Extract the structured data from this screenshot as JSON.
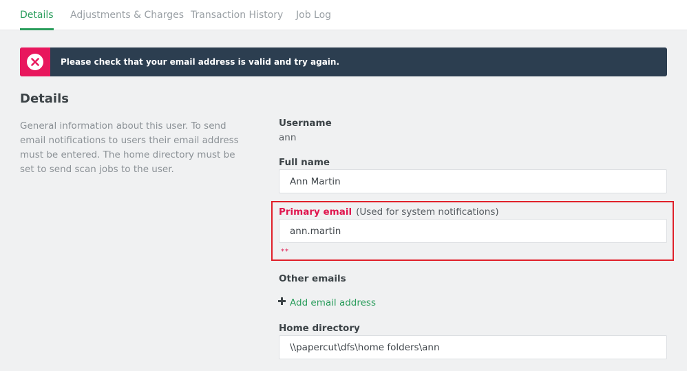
{
  "tabs": [
    {
      "label": "Details",
      "active": true
    },
    {
      "label": "Adjustments & Charges",
      "active": false
    },
    {
      "label": "Transaction History",
      "active": false
    },
    {
      "label": "Job Log",
      "active": false
    }
  ],
  "alert": {
    "message": "Please check that your email address is valid and try again.",
    "icon": "close-circle-icon",
    "color": "#e8175d"
  },
  "section": {
    "title": "Details",
    "description": "General information about this user. To send email notifications to users their email address must be entered. The home directory must be set to send scan jobs to the user."
  },
  "fields": {
    "username": {
      "label": "Username",
      "value": "ann"
    },
    "full_name": {
      "label": "Full name",
      "value": "Ann Martin"
    },
    "primary_email": {
      "label": "Primary email",
      "note": "(Used for system notifications)",
      "value": "ann.martin",
      "error": "**"
    },
    "other_emails": {
      "label": "Other emails",
      "add_label": "Add email address"
    },
    "home_directory": {
      "label": "Home directory",
      "value": "\\\\papercut\\dfs\\home folders\\ann"
    }
  },
  "colors": {
    "accent": "#2a9d5c",
    "error": "#e0174f",
    "alert_bg": "#2c3e50"
  }
}
